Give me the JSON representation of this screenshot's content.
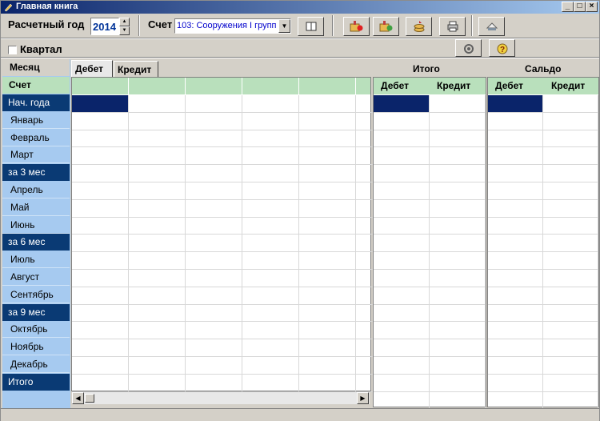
{
  "window": {
    "title": "Главная книга"
  },
  "toolbar": {
    "year_label": "Расчетный год",
    "year_value": "2014",
    "account_label": "Счет",
    "account_value": "103: Сооружения I групп",
    "buttons": [
      "book-icon",
      "folder-add-icon",
      "folder-edit-icon",
      "coins-icon",
      "printer-icon",
      "settings-icon"
    ]
  },
  "quarter": {
    "label": "Квартал",
    "checked": false
  },
  "month_header": "Месяц",
  "account_row_label": "Счет",
  "rows": [
    {
      "label": "Нач. года",
      "type": "period"
    },
    {
      "label": "Январь",
      "type": "month"
    },
    {
      "label": "Февраль",
      "type": "month"
    },
    {
      "label": "Март",
      "type": "month"
    },
    {
      "label": "за 3 мес",
      "type": "period"
    },
    {
      "label": "Апрель",
      "type": "month"
    },
    {
      "label": "Май",
      "type": "month"
    },
    {
      "label": "Июнь",
      "type": "month"
    },
    {
      "label": "за 6 мес",
      "type": "period"
    },
    {
      "label": "Июль",
      "type": "month"
    },
    {
      "label": "Август",
      "type": "month"
    },
    {
      "label": "Сентябрь",
      "type": "month"
    },
    {
      "label": "за 9 мес",
      "type": "period"
    },
    {
      "label": "Октябрь",
      "type": "month"
    },
    {
      "label": "Ноябрь",
      "type": "month"
    },
    {
      "label": "Декабрь",
      "type": "month"
    },
    {
      "label": "Итого",
      "type": "period"
    }
  ],
  "tabs": [
    "Дебет",
    "Кредит"
  ],
  "totals": {
    "title": "Итого",
    "debit": "Дебет",
    "credit": "Кредит"
  },
  "saldo": {
    "title": "Сальдо",
    "debit": "Дебет",
    "credit": "Кредит"
  },
  "colors": {
    "period_bg": "#0a3a74",
    "month_bg": "#a6caf0",
    "header_green": "#b9e0bc",
    "selection": "#0a246a"
  }
}
